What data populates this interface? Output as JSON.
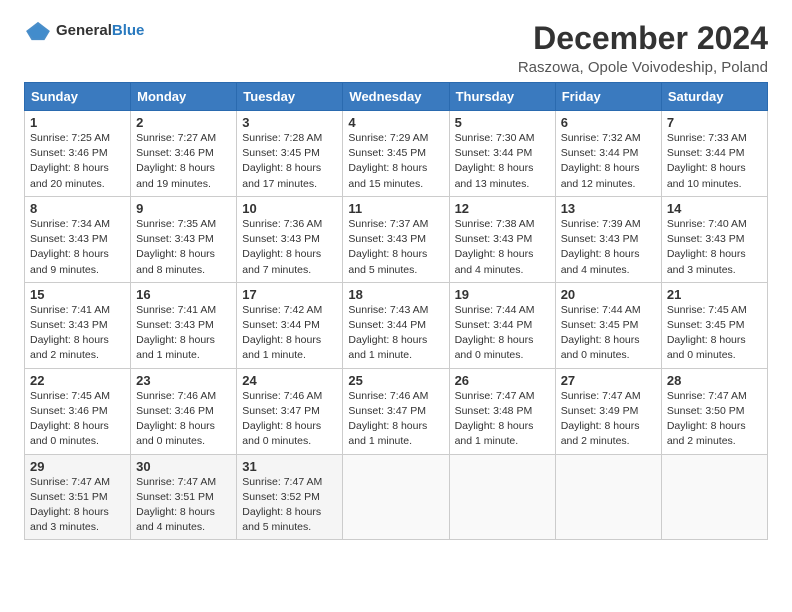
{
  "header": {
    "logo": {
      "general": "General",
      "blue": "Blue"
    },
    "title": "December 2024",
    "subtitle": "Raszowa, Opole Voivodeship, Poland"
  },
  "calendar": {
    "days_of_week": [
      "Sunday",
      "Monday",
      "Tuesday",
      "Wednesday",
      "Thursday",
      "Friday",
      "Saturday"
    ],
    "weeks": [
      [
        null,
        {
          "day": 2,
          "sunrise": "7:27 AM",
          "sunset": "3:46 PM",
          "daylight": "8 hours and 19 minutes."
        },
        {
          "day": 3,
          "sunrise": "7:28 AM",
          "sunset": "3:45 PM",
          "daylight": "8 hours and 17 minutes."
        },
        {
          "day": 4,
          "sunrise": "7:29 AM",
          "sunset": "3:45 PM",
          "daylight": "8 hours and 15 minutes."
        },
        {
          "day": 5,
          "sunrise": "7:30 AM",
          "sunset": "3:44 PM",
          "daylight": "8 hours and 13 minutes."
        },
        {
          "day": 6,
          "sunrise": "7:32 AM",
          "sunset": "3:44 PM",
          "daylight": "8 hours and 12 minutes."
        },
        {
          "day": 7,
          "sunrise": "7:33 AM",
          "sunset": "3:44 PM",
          "daylight": "8 hours and 10 minutes."
        }
      ],
      [
        {
          "day": 1,
          "sunrise": "7:25 AM",
          "sunset": "3:46 PM",
          "daylight": "8 hours and 20 minutes."
        },
        {
          "day": 9,
          "sunrise": "7:35 AM",
          "sunset": "3:43 PM",
          "daylight": "8 hours and 8 minutes."
        },
        {
          "day": 10,
          "sunrise": "7:36 AM",
          "sunset": "3:43 PM",
          "daylight": "8 hours and 7 minutes."
        },
        {
          "day": 11,
          "sunrise": "7:37 AM",
          "sunset": "3:43 PM",
          "daylight": "8 hours and 5 minutes."
        },
        {
          "day": 12,
          "sunrise": "7:38 AM",
          "sunset": "3:43 PM",
          "daylight": "8 hours and 4 minutes."
        },
        {
          "day": 13,
          "sunrise": "7:39 AM",
          "sunset": "3:43 PM",
          "daylight": "8 hours and 4 minutes."
        },
        {
          "day": 14,
          "sunrise": "7:40 AM",
          "sunset": "3:43 PM",
          "daylight": "8 hours and 3 minutes."
        }
      ],
      [
        {
          "day": 8,
          "sunrise": "7:34 AM",
          "sunset": "3:43 PM",
          "daylight": "8 hours and 9 minutes."
        },
        {
          "day": 16,
          "sunrise": "7:41 AM",
          "sunset": "3:43 PM",
          "daylight": "8 hours and 1 minute."
        },
        {
          "day": 17,
          "sunrise": "7:42 AM",
          "sunset": "3:44 PM",
          "daylight": "8 hours and 1 minute."
        },
        {
          "day": 18,
          "sunrise": "7:43 AM",
          "sunset": "3:44 PM",
          "daylight": "8 hours and 1 minute."
        },
        {
          "day": 19,
          "sunrise": "7:44 AM",
          "sunset": "3:44 PM",
          "daylight": "8 hours and 0 minutes."
        },
        {
          "day": 20,
          "sunrise": "7:44 AM",
          "sunset": "3:45 PM",
          "daylight": "8 hours and 0 minutes."
        },
        {
          "day": 21,
          "sunrise": "7:45 AM",
          "sunset": "3:45 PM",
          "daylight": "8 hours and 0 minutes."
        }
      ],
      [
        {
          "day": 15,
          "sunrise": "7:41 AM",
          "sunset": "3:43 PM",
          "daylight": "8 hours and 2 minutes."
        },
        {
          "day": 23,
          "sunrise": "7:46 AM",
          "sunset": "3:46 PM",
          "daylight": "8 hours and 0 minutes."
        },
        {
          "day": 24,
          "sunrise": "7:46 AM",
          "sunset": "3:47 PM",
          "daylight": "8 hours and 0 minutes."
        },
        {
          "day": 25,
          "sunrise": "7:46 AM",
          "sunset": "3:47 PM",
          "daylight": "8 hours and 1 minute."
        },
        {
          "day": 26,
          "sunrise": "7:47 AM",
          "sunset": "3:48 PM",
          "daylight": "8 hours and 1 minute."
        },
        {
          "day": 27,
          "sunrise": "7:47 AM",
          "sunset": "3:49 PM",
          "daylight": "8 hours and 2 minutes."
        },
        {
          "day": 28,
          "sunrise": "7:47 AM",
          "sunset": "3:50 PM",
          "daylight": "8 hours and 2 minutes."
        }
      ],
      [
        {
          "day": 22,
          "sunrise": "7:45 AM",
          "sunset": "3:46 PM",
          "daylight": "8 hours and 0 minutes."
        },
        {
          "day": 30,
          "sunrise": "7:47 AM",
          "sunset": "3:51 PM",
          "daylight": "8 hours and 4 minutes."
        },
        {
          "day": 31,
          "sunrise": "7:47 AM",
          "sunset": "3:52 PM",
          "daylight": "8 hours and 5 minutes."
        },
        null,
        null,
        null,
        null
      ],
      [
        {
          "day": 29,
          "sunrise": "7:47 AM",
          "sunset": "3:51 PM",
          "daylight": "8 hours and 3 minutes."
        },
        null,
        null,
        null,
        null,
        null,
        null
      ]
    ],
    "week_start_days": [
      1,
      8,
      15,
      22,
      29
    ]
  }
}
